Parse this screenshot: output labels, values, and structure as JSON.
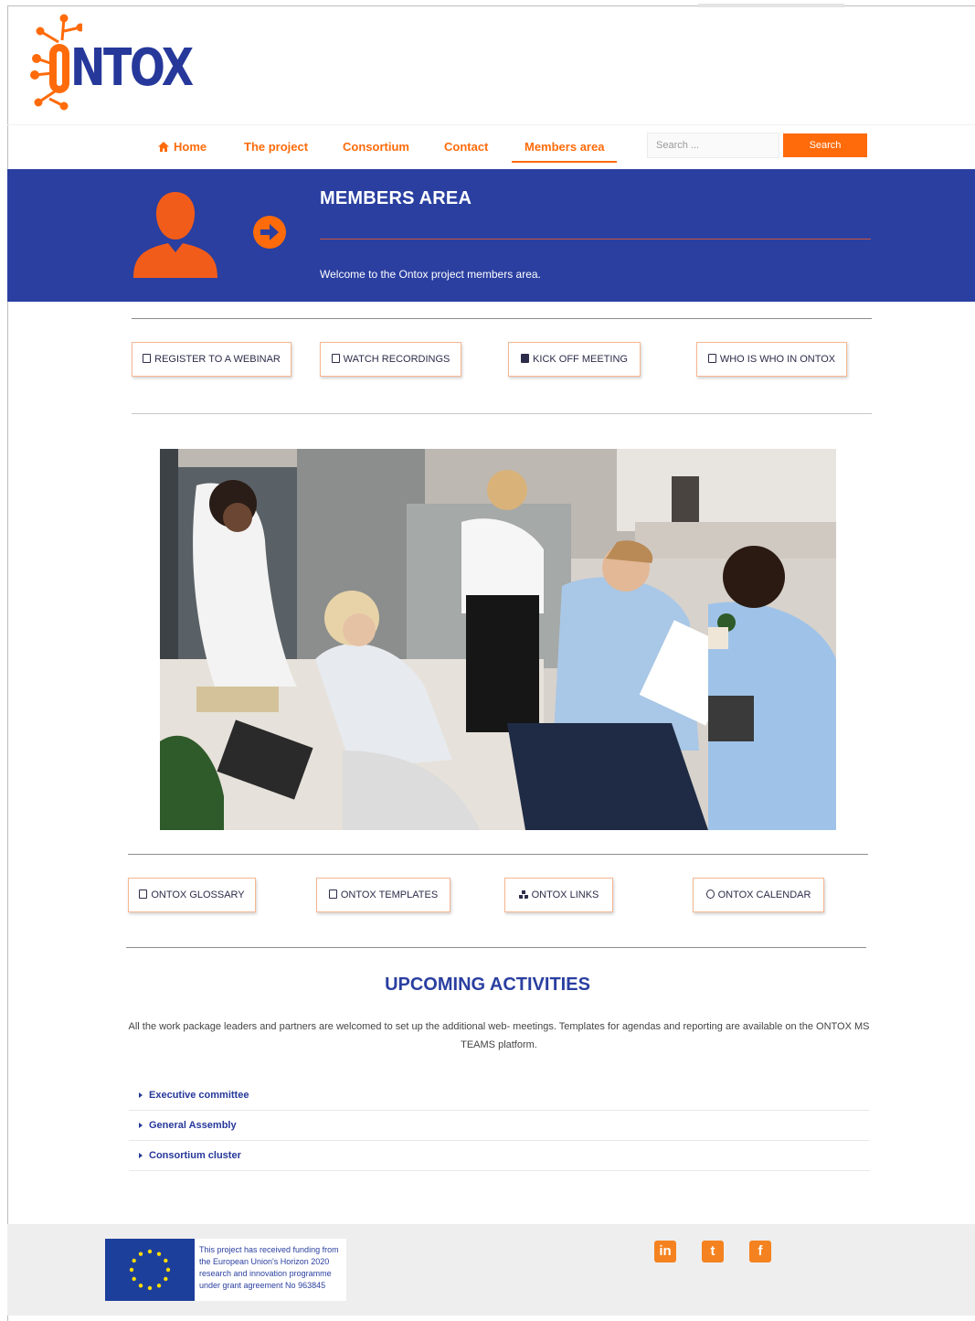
{
  "brand": {
    "logo_text": "NTOX",
    "logo_full": "ONTOX",
    "orange": "#ff6b0a",
    "blue": "#2a3fa0"
  },
  "nav": {
    "items": [
      {
        "label": "Home",
        "icon": "home-icon"
      },
      {
        "label": "The project"
      },
      {
        "label": "Consortium"
      },
      {
        "label": "Contact"
      },
      {
        "label": "Members area",
        "active": true
      }
    ],
    "search_placeholder": "Search ...",
    "search_button": "Search"
  },
  "hero": {
    "title": "MEMBERS AREA",
    "subtitle": "Welcome to the Ontox project members area.",
    "icons": [
      "user-icon",
      "arrow-right-circle-icon"
    ]
  },
  "buttons_top": [
    {
      "label": "REGISTER TO A WEBINAR",
      "icon": "calendar-icon"
    },
    {
      "label": "WATCH RECORDINGS",
      "icon": "play-icon"
    },
    {
      "label": "KICK OFF MEETING",
      "icon": "video-icon"
    },
    {
      "label": "WHO IS WHO IN ONTOX",
      "icon": "contact-book-icon"
    }
  ],
  "buttons_bottom": [
    {
      "label": "ONTOX GLOSSARY",
      "icon": "document-icon"
    },
    {
      "label": "ONTOX TEMPLATES",
      "icon": "document-icon"
    },
    {
      "label": "ONTOX LINKS",
      "icon": "sitemap-icon"
    },
    {
      "label": "ONTOX CALENDAR",
      "icon": "clock-icon"
    }
  ],
  "activities": {
    "title": "UPCOMING ACTIVITIES",
    "text": "All the work package leaders and partners are welcomed to set up the additional web- meetings. Templates for agendas and reporting are available on the ONTOX MS TEAMS platform.",
    "items": [
      "Executive committee",
      "General Assembly",
      "Consortium cluster"
    ]
  },
  "footer": {
    "funding_text": "This project has received funding from the European Union's Horizon 2020 research and innovation programme under grant agreement No 963845",
    "social": [
      {
        "label": "in",
        "icon": "linkedin-icon"
      },
      {
        "label": "t",
        "icon": "twitter-icon"
      },
      {
        "label": "f",
        "icon": "facebook-icon"
      }
    ]
  }
}
